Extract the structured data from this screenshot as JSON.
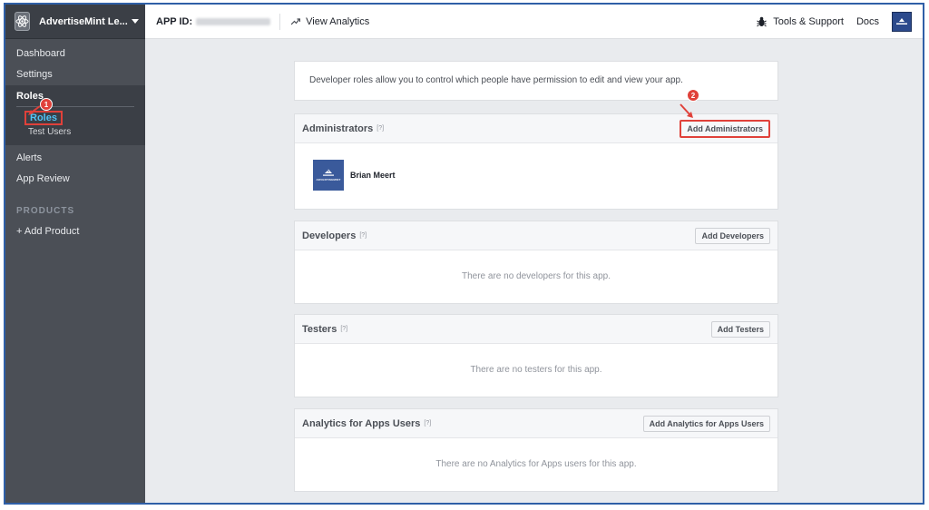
{
  "sidebar": {
    "app_name": "AdvertiseMint Le...",
    "items": {
      "dashboard": "Dashboard",
      "settings": "Settings",
      "roles": "Roles",
      "roles_sub": "Roles",
      "test_users": "Test Users",
      "alerts": "Alerts",
      "app_review": "App Review"
    },
    "products_label": "PRODUCTS",
    "add_product": "+ Add Product"
  },
  "topbar": {
    "app_id_label": "APP ID:",
    "view_analytics": "View Analytics",
    "tools_support": "Tools & Support",
    "docs": "Docs"
  },
  "intro_text": "Developer roles allow you to control which people have permission to edit and view your app.",
  "help_marker": "[?]",
  "sections": {
    "administrators": {
      "title": "Administrators",
      "button": "Add Administrators",
      "admin_name": "Brian Meert",
      "admin_logo_text": "ADVERTISEMINT"
    },
    "developers": {
      "title": "Developers",
      "button": "Add Developers",
      "empty": "There are no developers for this app."
    },
    "testers": {
      "title": "Testers",
      "button": "Add Testers",
      "empty": "There are no testers for this app."
    },
    "analytics": {
      "title": "Analytics for Apps Users",
      "button": "Add Analytics for Apps Users",
      "empty": "There are no Analytics for Apps users for this app."
    }
  },
  "annotations": {
    "step1": "1",
    "step2": "2"
  },
  "colors": {
    "sidebar": "#4b4f56",
    "highlight": "#e0413a",
    "active_link": "#4fc3f7",
    "frame": "#2f5fa7"
  },
  "icons": {
    "app": "atom-icon",
    "analytics": "trend-icon",
    "tools": "bug-icon",
    "avatar": "advertisemint-logo"
  }
}
